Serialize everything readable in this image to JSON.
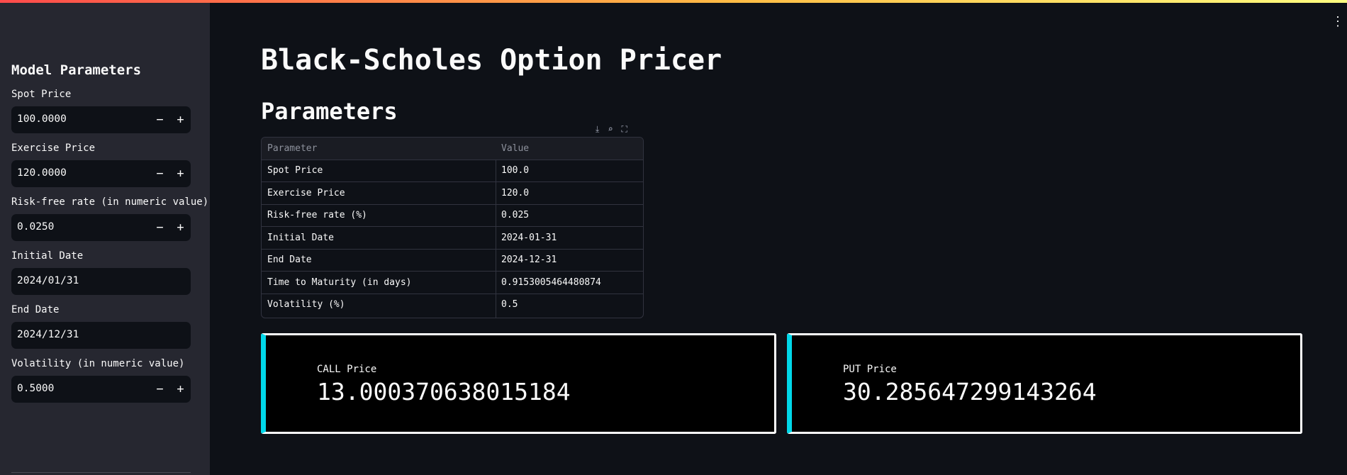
{
  "app": {
    "title": "Black-Scholes Option Pricer",
    "section_title": "Parameters",
    "menu_icon": "vertical-ellipsis-icon",
    "accent_colors": {
      "metric_border": "#00d8ea",
      "top_bar_start": "#ff4b4b",
      "top_bar_end": "#fffd80"
    }
  },
  "sidebar": {
    "title": "Model Parameters",
    "fields": [
      {
        "label": "Spot Price",
        "value": "100.0000",
        "stepper": true
      },
      {
        "label": "Exercise Price",
        "value": "120.0000",
        "stepper": true
      },
      {
        "label": "Risk-free rate (in numeric value)",
        "value": "0.0250",
        "stepper": true
      },
      {
        "label": "Initial Date",
        "value": "2024/01/31",
        "stepper": false
      },
      {
        "label": "End Date",
        "value": "2024/12/31",
        "stepper": false
      },
      {
        "label": "Volatility (in numeric value)",
        "value": "0.5000",
        "stepper": true
      }
    ],
    "minus": "−",
    "plus": "+"
  },
  "table": {
    "toolbar_icons": [
      "download-icon",
      "search-icon",
      "fullscreen-icon"
    ],
    "headers": [
      "Parameter",
      "Value"
    ],
    "rows": [
      [
        "Spot Price",
        "100.0"
      ],
      [
        "Exercise Price",
        "120.0"
      ],
      [
        "Risk-free rate (%)",
        "0.025"
      ],
      [
        "Initial Date",
        "2024-01-31"
      ],
      [
        "End Date",
        "2024-12-31"
      ],
      [
        "Time to Maturity (in days)",
        "0.9153005464480874"
      ],
      [
        "Volatility (%)",
        "0.5"
      ]
    ]
  },
  "metrics": {
    "call": {
      "label": "CALL Price",
      "value": "13.000370638015184"
    },
    "put": {
      "label": "PUT Price",
      "value": "30.285647299143264"
    }
  }
}
